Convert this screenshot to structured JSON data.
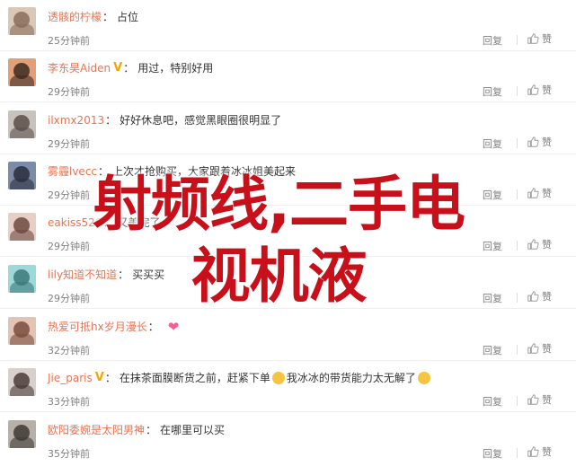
{
  "comments": [
    {
      "user": "透骸的柠檬",
      "badge": "",
      "badge_color": "#6cb0e8",
      "text": "占位",
      "time": "25分钟前",
      "avatar_colors": [
        "#d9c7b8",
        "#8a6d5a"
      ]
    },
    {
      "user": "李东昊Aiden",
      "badge": "",
      "badge_color": "#6cb0e8",
      "text": "用过，特别好用",
      "time": "29分钟前",
      "avatar_colors": [
        "#e2a07a",
        "#3c2a20"
      ]
    },
    {
      "user": "ilxmx2013",
      "badge": "",
      "badge_color": "#6cb0e8",
      "text": "好好休息吧，感觉黑眼圈很明显了",
      "time": "29分钟前",
      "avatar_colors": [
        "#c8c2bc",
        "#5b5049"
      ]
    },
    {
      "user": "雾霾lvecc",
      "badge": "",
      "badge_color": "#6cb0e8",
      "text": "上次才抢购买，大家跟着冰冰姐美起来",
      "time": "29分钟前",
      "avatar_colors": [
        "#7b8ba8",
        "#2a2e3d"
      ]
    },
    {
      "user": "eakiss520",
      "badge": "",
      "badge_color": "#6cb0e8",
      "text": "又美完了",
      "time": "29分钟前",
      "avatar_colors": [
        "#e8cfc6",
        "#6e4a40"
      ]
    },
    {
      "user": "lily知道不知道",
      "badge": "",
      "badge_color": "#f2a33a",
      "text": "买买买",
      "time": "29分钟前",
      "avatar_colors": [
        "#9fd8d8",
        "#3b7a7a"
      ]
    },
    {
      "user": "热爱可抵hx岁月漫长",
      "badge": "",
      "badge_color": "#6cb0e8",
      "text": "",
      "time": "32分钟前",
      "avatar_colors": [
        "#e3c3b4",
        "#7a4e3e"
      ]
    },
    {
      "user": "Jie_paris",
      "badge": "",
      "badge_color": "#f2a33a",
      "text": "在抹茶面膜断货之前，赶紧下单",
      "text2": "我冰冰的带货能力太无解了",
      "time": "33分钟前",
      "avatar_colors": [
        "#d8d0cc",
        "#4a3c38"
      ]
    },
    {
      "user": "欧阳委婉是太阳男神",
      "badge": "",
      "badge_color": "#6cb0e8",
      "text": "在哪里可以买",
      "time": "35分钟前",
      "avatar_colors": [
        "#b7b0a8",
        "#403a36"
      ]
    }
  ],
  "reply_label": "回复",
  "like_label": "赞",
  "overlay_title": "射频线,二手电视机液",
  "overlay_line1": "射频线,二手电",
  "overlay_line2": "视机液",
  "accent_color": "#eb7350",
  "overlay_color": "#c8101a"
}
